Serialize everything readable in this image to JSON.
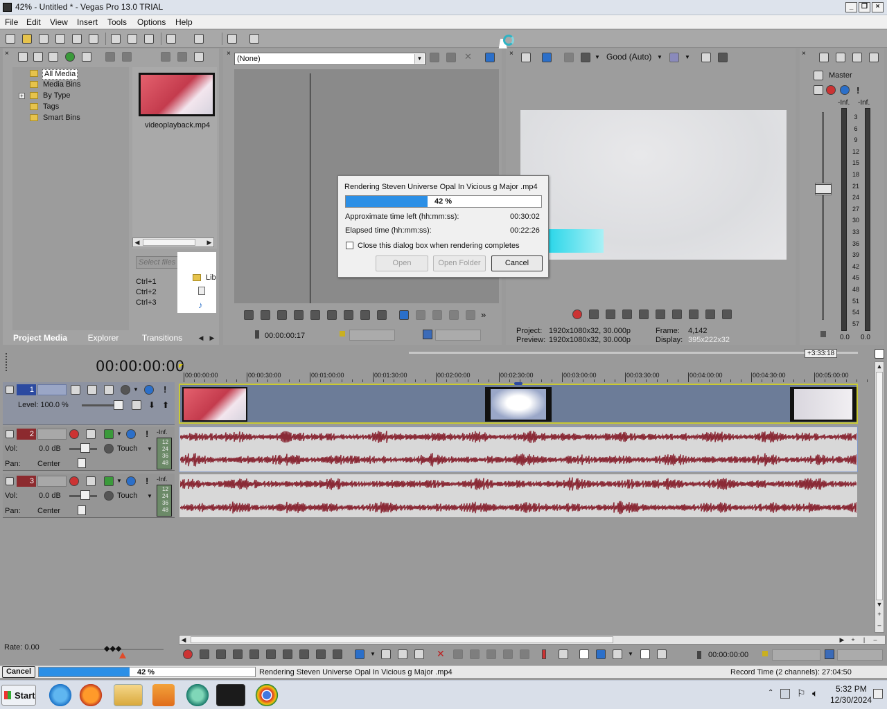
{
  "window": {
    "title": "42% - Untitled * - Vegas Pro 13.0 TRIAL"
  },
  "menu": [
    "File",
    "Edit",
    "View",
    "Insert",
    "Tools",
    "Options",
    "Help"
  ],
  "media": {
    "tree": [
      "All Media",
      "Media Bins",
      "By Type",
      "Tags",
      "Smart Bins"
    ],
    "file_name": "videoplayback.mp4",
    "search_placeholder": "Select files to edit tags",
    "shortcuts": [
      "Ctrl+1",
      "Ctrl+2",
      "Ctrl+3"
    ],
    "lib_label": "Lib"
  },
  "tabs": [
    "Project Media",
    "Explorer",
    "Transitions"
  ],
  "trimmer": {
    "dropdown_value": "(None)",
    "timecode": "00:00:00:17"
  },
  "preview": {
    "quality": "Good (Auto)",
    "project_label": "Project:",
    "project_value": "1920x1080x32, 30.000p",
    "preview_label": "Preview:",
    "preview_value": "1920x1080x32, 30.000p",
    "frame_label": "Frame:",
    "frame_value": "4,142",
    "display_label": "Display:",
    "display_value": "395x222x32"
  },
  "master": {
    "title": "Master",
    "inf_left": "-Inf.",
    "inf_right": "-Inf.",
    "scale": [
      "3",
      "6",
      "9",
      "12",
      "15",
      "18",
      "21",
      "24",
      "27",
      "30",
      "33",
      "36",
      "39",
      "42",
      "45",
      "48",
      "51",
      "54",
      "57"
    ],
    "bottom_left": "0.0",
    "bottom_right": "0.0"
  },
  "render_dialog": {
    "title": "Rendering Steven Universe Opal In Vicious g Major .mp4",
    "progress": 42,
    "progress_label": "42 %",
    "time_left_label": "Approximate time left (hh:mm:ss):",
    "time_left_value": "00:30:02",
    "elapsed_label": "Elapsed time (hh:mm:ss):",
    "elapsed_value": "00:22:26",
    "checkbox_label": "Close this dialog box when rendering completes",
    "open_btn": "Open",
    "open_folder_btn": "Open Folder",
    "cancel_btn": "Cancel"
  },
  "timeline": {
    "timecode": "00:00:00:00",
    "badge": "+3:33:18",
    "ruler": [
      "00:00:00:00",
      "00:00:30:00",
      "00:01:00:00",
      "00:01:30:00",
      "00:02:00:00",
      "00:02:30:00",
      "00:03:00:00",
      "00:03:30:00",
      "00:04:00:00",
      "00:04:30:00",
      "00:05:00:00"
    ],
    "video_track": {
      "num": "1",
      "level": "Level: 100.0 %"
    },
    "audio_tracks": [
      {
        "num": "2",
        "vol_label": "Vol:",
        "vol": "0.0 dB",
        "pan_label": "Pan:",
        "pan": "Center",
        "mode": "Touch",
        "inf": "-Inf.",
        "ticks": [
          "12",
          "24",
          "36",
          "48"
        ]
      },
      {
        "num": "3",
        "vol_label": "Vol:",
        "vol": "0.0 dB",
        "pan_label": "Pan:",
        "pan": "Center",
        "mode": "Touch",
        "inf": "-Inf.",
        "ticks": [
          "12",
          "24",
          "36",
          "48"
        ]
      }
    ],
    "rate": "Rate: 0.00",
    "transport_timecode": "00:00:00:00"
  },
  "status": {
    "cancel": "Cancel",
    "progress": 42,
    "progress_label": "42 %",
    "message": "Rendering Steven Universe Opal In Vicious g Major .mp4",
    "record_time": "Record Time (2 channels): 27:04:50"
  },
  "taskbar": {
    "start": "Start",
    "time": "5:32 PM",
    "date": "12/30/2024"
  },
  "colors": {
    "accent": "#2b8fe6",
    "wave": "#8a2a36",
    "audio_lane": "#d8d8d8",
    "video_lane": "#6c7c98",
    "clip_border": "#c9c933"
  }
}
